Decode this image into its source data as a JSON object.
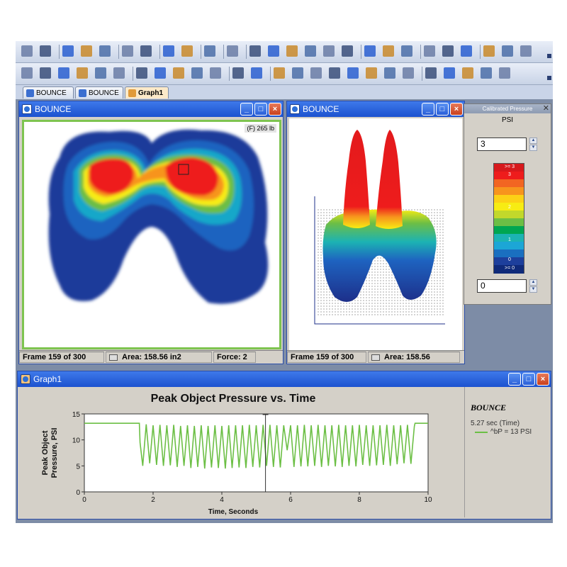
{
  "tabs": [
    {
      "label": "BOUNCE"
    },
    {
      "label": "BOUNCE"
    },
    {
      "label": "Graph1"
    }
  ],
  "window_2d": {
    "title": "BOUNCE",
    "overlay_label": "(F) 265 lb",
    "status": {
      "frame": "Frame 159 of 300",
      "area": "Area: 158.56 in2",
      "force": "Force: 2"
    }
  },
  "window_3d": {
    "title": "BOUNCE",
    "status": {
      "frame": "Frame 159 of 300",
      "area": "Area: 158.56"
    }
  },
  "legend_panel": {
    "title": "Calibrated Pressure",
    "unit": "PSI",
    "max_value": "3",
    "min_value": "0",
    "scale_labels": [
      ">= 3",
      "3",
      "2",
      "1",
      "0",
      ">= 0"
    ],
    "colors": [
      "#d7191c",
      "#ee1c1c",
      "#f26522",
      "#f7941d",
      "#fcd116",
      "#f7ec13",
      "#c2d82b",
      "#6cbe45",
      "#00a651",
      "#1cb3b3",
      "#1ca6d6",
      "#1a6fc0",
      "#1d3f9c",
      "#0f2a7a"
    ]
  },
  "graph_window": {
    "title": "Graph1",
    "sidebar_title": "BOUNCE",
    "cursor_readout": "5.27 sec (Time)",
    "series_label": "^bP = 13 PSI"
  },
  "chart_data": {
    "type": "line",
    "title": "Peak Object Pressure vs. Time",
    "xlabel": "Time, Seconds",
    "ylabel_lines": [
      "Peak Object",
      "Pressure, PSI"
    ],
    "xlim": [
      0,
      10
    ],
    "ylim": [
      0,
      15
    ],
    "xticks": [
      0,
      2,
      4,
      6,
      8,
      10
    ],
    "yticks": [
      0,
      5,
      10,
      15
    ],
    "cursor_x": 5.27,
    "series": [
      {
        "color": "#6cbf45",
        "x": [
          0.0,
          1.6,
          1.62,
          1.7,
          1.8,
          1.9,
          2.0,
          2.1,
          2.2,
          2.3,
          2.4,
          2.5,
          2.6,
          2.7,
          2.8,
          2.9,
          3.0,
          3.1,
          3.2,
          3.3,
          3.4,
          3.5,
          3.6,
          3.7,
          3.8,
          3.9,
          4.0,
          4.1,
          4.2,
          4.3,
          4.4,
          4.5,
          4.6,
          4.7,
          4.8,
          4.9,
          5.0,
          5.1,
          5.2,
          5.3,
          5.4,
          5.5,
          5.6,
          5.7,
          5.8,
          5.9,
          6.0,
          6.1,
          6.2,
          6.3,
          6.4,
          6.5,
          6.6,
          6.7,
          6.8,
          6.9,
          7.0,
          7.1,
          7.2,
          7.3,
          7.4,
          7.5,
          7.6,
          7.7,
          7.8,
          7.9,
          8.0,
          8.1,
          8.2,
          8.3,
          8.4,
          8.5,
          8.6,
          8.7,
          8.8,
          8.9,
          9.0,
          9.1,
          9.2,
          9.3,
          9.4,
          9.5,
          9.6,
          9.62,
          10.0
        ],
        "y": [
          13.2,
          13.2,
          9.5,
          5.0,
          13.0,
          5.5,
          12.8,
          5.2,
          12.9,
          5.0,
          12.8,
          5.1,
          12.9,
          4.8,
          12.7,
          5.0,
          12.8,
          4.6,
          12.7,
          4.8,
          12.8,
          4.5,
          12.7,
          4.7,
          12.8,
          4.6,
          12.7,
          4.5,
          12.8,
          4.6,
          12.8,
          4.7,
          12.8,
          4.6,
          12.9,
          4.8,
          12.8,
          4.7,
          12.9,
          5.0,
          12.9,
          4.8,
          12.8,
          4.7,
          12.8,
          8.0,
          12.8,
          4.8,
          12.8,
          4.9,
          12.9,
          4.9,
          12.8,
          5.0,
          12.9,
          4.8,
          12.8,
          5.0,
          12.8,
          4.9,
          12.9,
          4.8,
          12.8,
          5.0,
          12.8,
          4.9,
          12.9,
          5.2,
          12.8,
          5.0,
          12.8,
          5.1,
          12.8,
          5.2,
          12.9,
          5.0,
          12.8,
          5.3,
          12.8,
          5.5,
          12.9,
          5.4,
          12.6,
          13.2,
          13.2
        ]
      }
    ]
  }
}
